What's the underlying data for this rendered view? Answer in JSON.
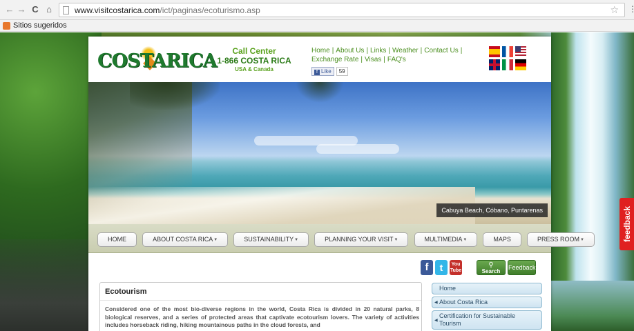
{
  "browser": {
    "url_domain": "www.visitcostarica.com",
    "url_path": "/ict/paginas/ecoturismo.asp",
    "bookmarks_label": "Sitios sugeridos"
  },
  "header": {
    "logo_text_1": "COSTA",
    "logo_text_2": "RICA",
    "call_center_title": "Call Center",
    "call_center_number": "1-866 COSTA RICA",
    "call_center_region": "USA & Canada",
    "links": [
      "Home",
      "About Us",
      "Links",
      "Weather",
      "Contact Us",
      "Exchange Rate",
      "Visas",
      "FAQ's"
    ],
    "fb_like": "Like",
    "fb_count": "59",
    "flags": [
      "spain-flag",
      "france-flag",
      "usa-flag",
      "uk-flag",
      "italy-flag",
      "germany-flag"
    ]
  },
  "hero": {
    "caption": "Cabuya Beach, Cóbano, Puntarenas"
  },
  "mainnav": [
    "HOME",
    "ABOUT COSTA RICA",
    "SUSTAINABILITY",
    "PLANNING YOUR VISIT",
    "MULTIMEDIA",
    "MAPS",
    "PRESS ROOM"
  ],
  "social": {
    "search_label": "Search",
    "feedback_label": "Feedback",
    "youtube_label": "You Tube"
  },
  "article": {
    "title": "Ecotourism",
    "body": "Considered one of the most bio-diverse regions in the world, Costa Rica is divided in 20 natural parks, 8 biological reserves, and a series of protected areas that captivate ecotourism lovers. The variety of activities includes horseback riding, hiking mountainous paths in the cloud forests, and"
  },
  "sidenav": [
    "Home",
    "About Costa Rica",
    "Certification for Sustainable Tourism"
  ],
  "feedback_tab": "feedback"
}
